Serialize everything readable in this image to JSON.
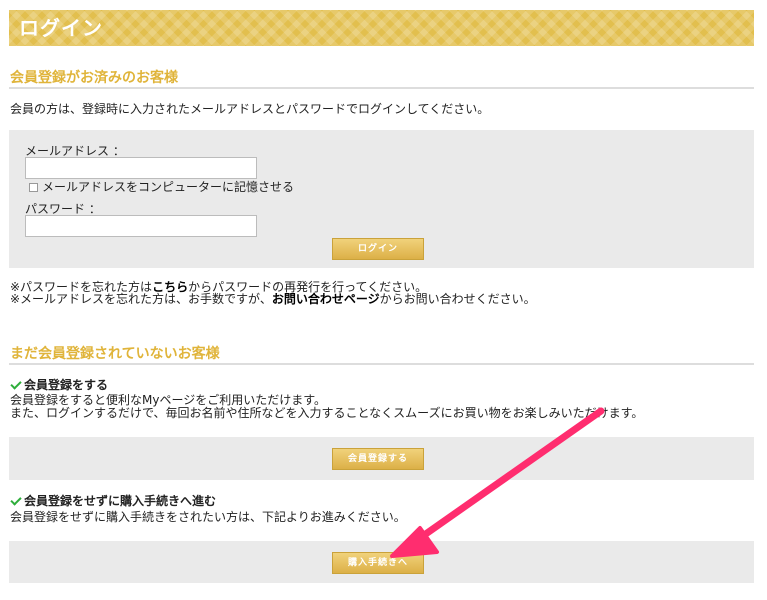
{
  "header": {
    "title": "ログイン"
  },
  "member_section": {
    "title": "会員登録がお済みのお客様",
    "intro": "会員の方は、登録時に入力されたメールアドレスとパスワードでログインしてください。",
    "email_label": "メールアドレス ：",
    "email_value": "",
    "remember_label": "メールアドレスをコンピューターに記憶させる",
    "password_label": "パスワード ：",
    "password_value": "",
    "login_button": "ログイン",
    "forgot_pw_prefix": "※パスワードを忘れた方は",
    "forgot_pw_link": "こちら",
    "forgot_pw_suffix": "からパスワードの再発行を行ってください。",
    "forgot_mail_prefix": "※メールアドレスを忘れた方は、お手数ですが、",
    "forgot_mail_link": "お問い合わせページ",
    "forgot_mail_suffix": "からお問い合わせください。"
  },
  "guest_section": {
    "title": "まだ会員登録されていないお客様",
    "register_heading": "会員登録をする",
    "register_text1": "会員登録をすると便利なMyページをご利用いただけます。",
    "register_text2": "また、ログインするだけで、毎回お名前や住所などを入力することなくスムーズにお買い物をお楽しみいただけます。",
    "register_button": "会員登録する",
    "guest_heading": "会員登録をせずに購入手続きへ進む",
    "guest_text": "会員登録をせずに購入手続きをされたい方は、下記よりお進みください。",
    "guest_button": "購入手続きへ"
  },
  "colors": {
    "accent": "#e0b43a",
    "arrow": "#ff2d6f"
  }
}
